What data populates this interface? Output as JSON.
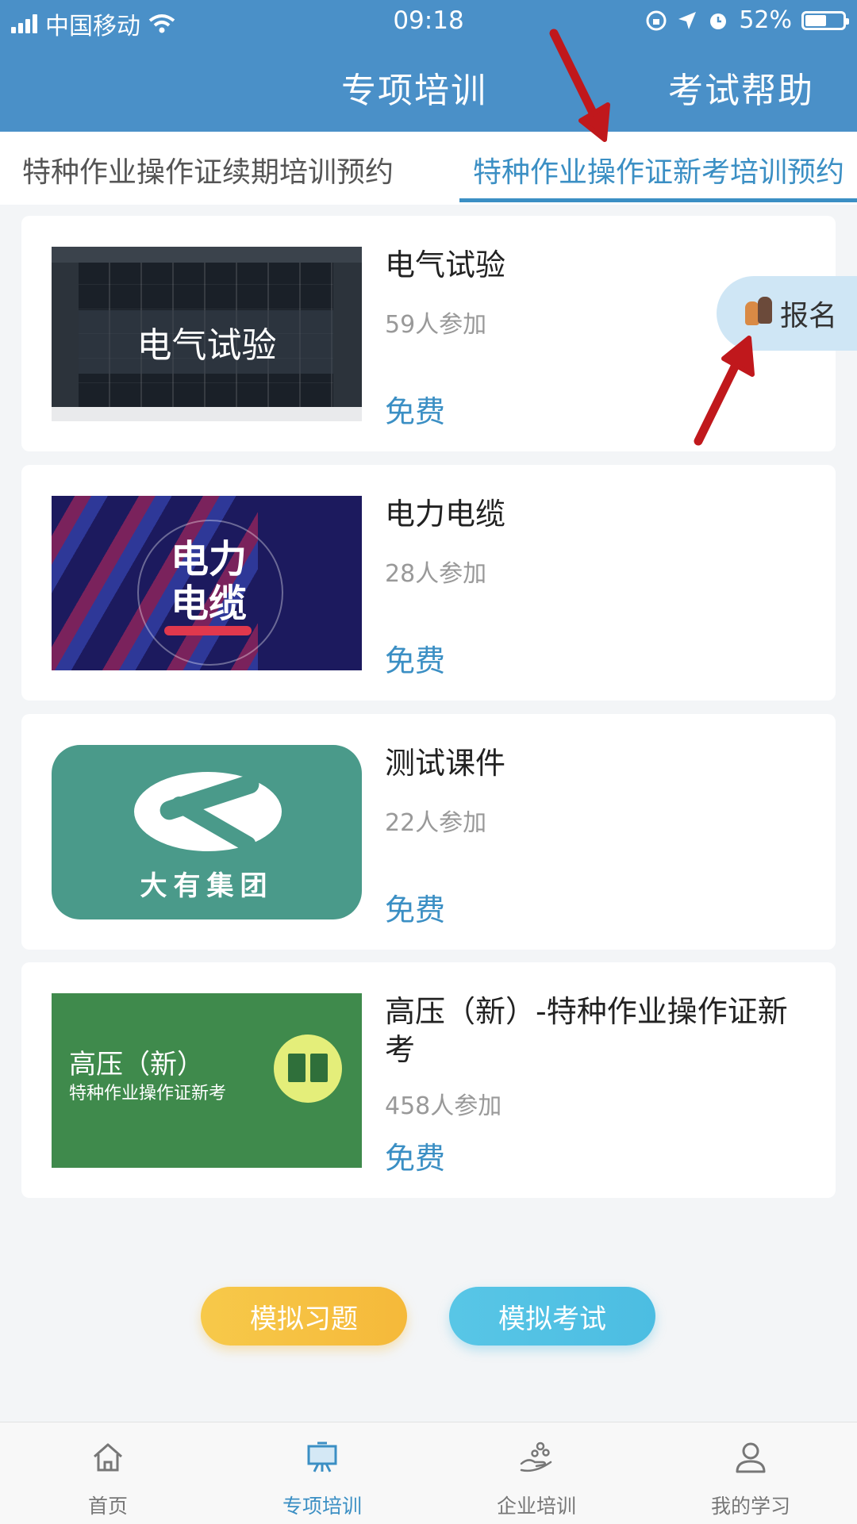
{
  "status_bar": {
    "carrier": "中国移动",
    "time": "09:18",
    "battery": "52%"
  },
  "header": {
    "title": "专项培训",
    "help": "考试帮助"
  },
  "tabs": [
    {
      "label": "特种作业操作证续期培训预约",
      "active": false
    },
    {
      "label": "特种作业操作证新考培训预约",
      "active": true
    }
  ],
  "courses": [
    {
      "title": "电气试验",
      "count": "59人参加",
      "price": "免费",
      "thumb_text": "电气试验"
    },
    {
      "title": "电力电缆",
      "count": "28人参加",
      "price": "免费",
      "thumb_text": "电力电缆"
    },
    {
      "title": "测试课件",
      "count": "22人参加",
      "price": "免费",
      "thumb_text": "大有集团"
    },
    {
      "title": "高压（新）-特种作业操作证新考",
      "count": "458人参加",
      "price": "免费",
      "thumb_text": "高压（新）",
      "thumb_subtext": "特种作业操作证新考"
    }
  ],
  "signup": {
    "label": "报名"
  },
  "actions": {
    "practice": "模拟习题",
    "exam": "模拟考试"
  },
  "tabbar": [
    {
      "label": "首页",
      "icon": "home-icon"
    },
    {
      "label": "专项培训",
      "icon": "easel-icon",
      "active": true
    },
    {
      "label": "企业培训",
      "icon": "hand-people-icon"
    },
    {
      "label": "我的学习",
      "icon": "person-icon"
    }
  ],
  "colors": {
    "header": "#4a90c8",
    "accent": "#3b8fc4",
    "practice": "#f5b93a",
    "exam": "#4cbde2",
    "annotation": "#c0181c"
  }
}
